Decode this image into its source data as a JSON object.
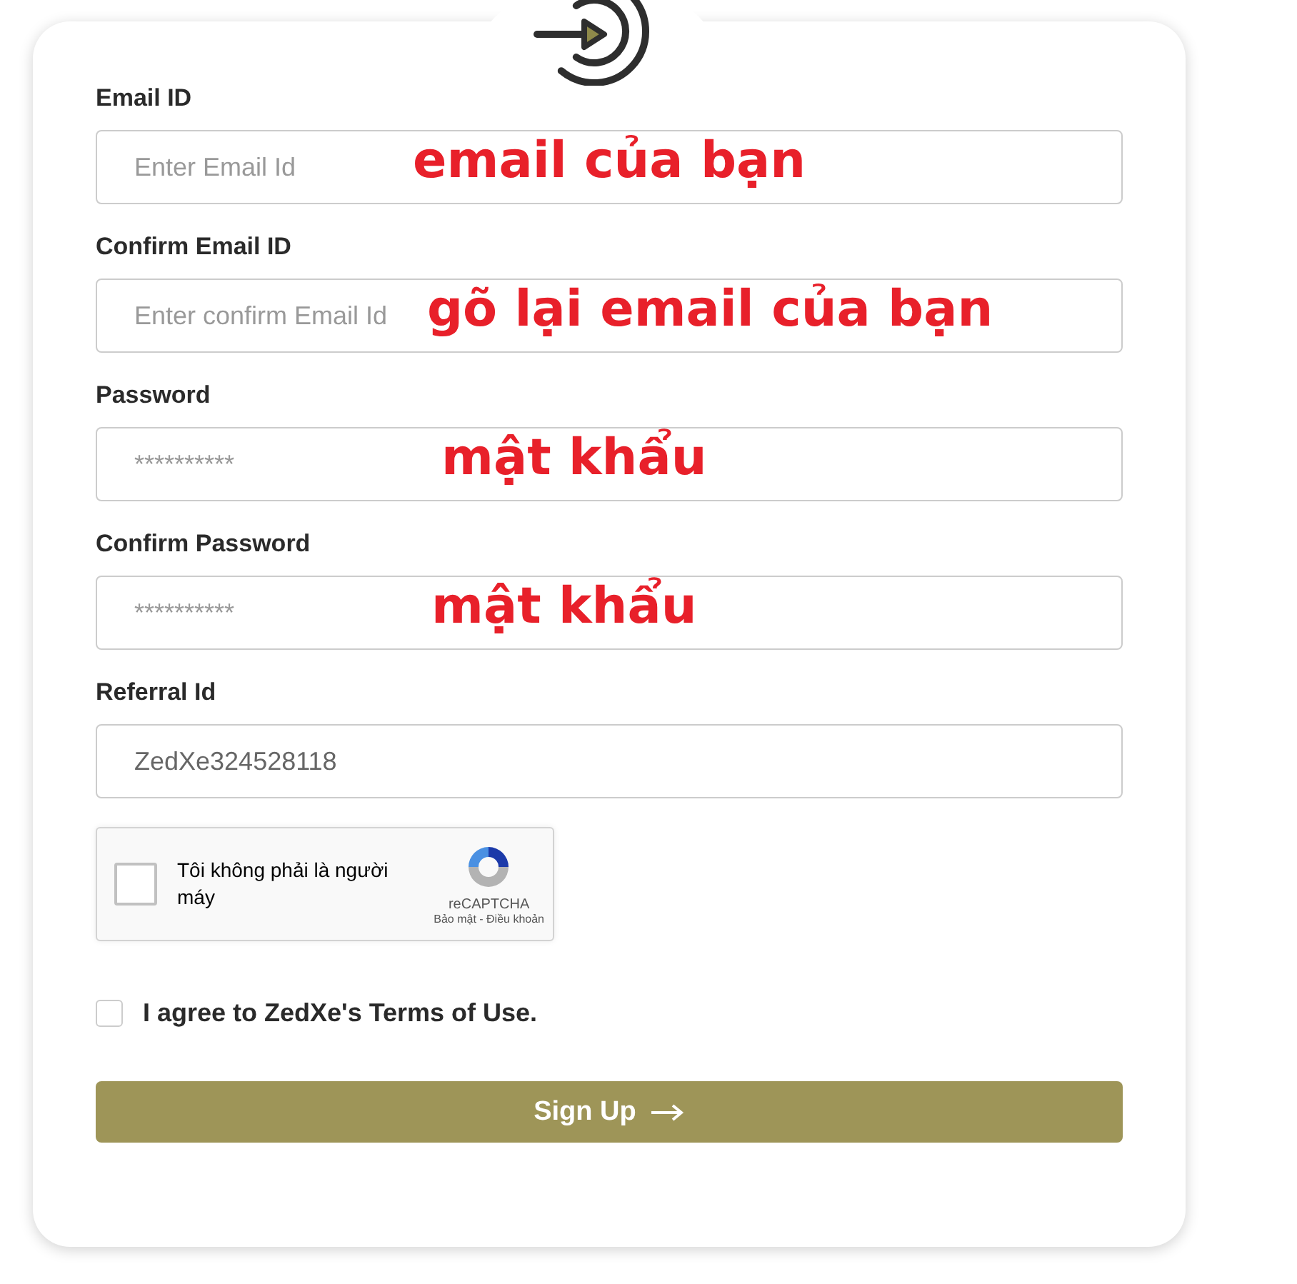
{
  "fields": [
    {
      "label": "Email ID",
      "placeholder": "Enter Email Id",
      "annotation": "email của bạn"
    },
    {
      "label": "Confirm Email ID",
      "placeholder": "Enter confirm Email Id",
      "annotation": "gõ lại email của bạn"
    },
    {
      "label": "Password",
      "placeholder": "**********",
      "annotation": "mật khẩu"
    },
    {
      "label": "Confirm Password",
      "placeholder": "**********",
      "annotation": "mật khẩu"
    },
    {
      "label": "Referral Id",
      "value": "ZedXe324528118"
    }
  ],
  "captcha": {
    "checked": false,
    "label": "Tôi không phải là người máy",
    "brand": "reCAPTCHA",
    "links": "Bảo mật - Điều khoản"
  },
  "terms": {
    "checked": false,
    "label": "I agree to ZedXe's Terms of Use."
  },
  "submit": {
    "label": "Sign Up"
  }
}
